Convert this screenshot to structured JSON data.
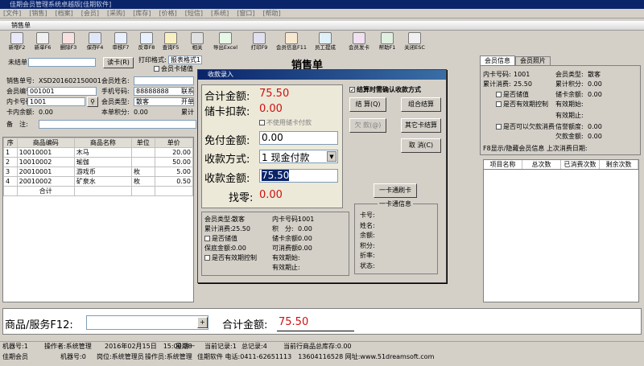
{
  "app": {
    "title": "佳期会员管理系统卓越版[佳期软件]"
  },
  "menu": [
    "[文件]",
    "[销售]",
    "[档案]",
    "[会员]",
    "[采购]",
    "[库存]",
    "[价格]",
    "[短信]",
    "[系统]",
    "[窗口]",
    "[帮助]"
  ],
  "window_title": "销售单",
  "toolbar": [
    {
      "label": "新增F2"
    },
    {
      "label": "新单F6"
    },
    {
      "label": "删除F3"
    },
    {
      "label": "保存F4"
    },
    {
      "label": "审核F7"
    },
    {
      "label": "反审F8"
    },
    {
      "label": "查询F5"
    },
    {
      "label": "相关"
    },
    {
      "label": "导出Excel"
    },
    {
      "label": "打印F9"
    },
    {
      "label": "会员信息F11"
    },
    {
      "label": "员工提成"
    },
    {
      "label": "会员发卡"
    },
    {
      "label": "帮助F1"
    },
    {
      "label": "关闭ESC"
    }
  ],
  "header": {
    "unit_label": "未结单",
    "readcard_btn": "读卡(R)",
    "print_format_label": "打印格式:",
    "print_format_value": "报表格式1",
    "member_check_label": "会员卡储值",
    "doc_title": "销售单",
    "sale_no_label": "销售单号:",
    "sale_no": "XSD201602150001",
    "member_name_label": "会员姓名:",
    "member_no_label": "会员编号:",
    "member_no": "001001",
    "phone_label": "手机号码:",
    "phone": "88888888",
    "contact_label": "联系",
    "card_no_label": "内卡号码:",
    "card_no": "1001",
    "member_type_label": "会员类型:",
    "member_type": "散客",
    "operator_label": "开单",
    "card_balance_label": "卡内余额:",
    "card_balance": "0.00",
    "points_label": "本单积分:",
    "points": "0.00",
    "accum_label": "累计",
    "remark_label": "备　注:"
  },
  "grid": {
    "columns": [
      "序",
      "商品编码",
      "商品名称",
      "单位",
      "单价"
    ],
    "rows": [
      {
        "no": "1",
        "code": "10010001",
        "name": "木马",
        "unit": "",
        "price": "20.00"
      },
      {
        "no": "2",
        "code": "10010002",
        "name": "瑜伽",
        "unit": "",
        "price": "50.00"
      },
      {
        "no": "3",
        "code": "20010001",
        "name": "游戏币",
        "unit": "枚",
        "price": "5.00"
      },
      {
        "no": "4",
        "code": "20010002",
        "name": "矿泉水",
        "unit": "枚",
        "price": "0.50"
      }
    ],
    "total_label": "合计"
  },
  "dialog": {
    "title": "收款录入",
    "total_label": "合计金额:",
    "total": "75.50",
    "card_deduct_label": "储卡扣款:",
    "card_deduct": "0.00",
    "no_card_label": "不使用储卡付款",
    "free_label": "免付金额:",
    "free": "0.00",
    "pay_method_label": "收款方式:",
    "pay_method_no": "1",
    "pay_method": "现金付款",
    "received_label": "收款金额:",
    "received": "75.50",
    "change_label": "找零:",
    "change": "0.00",
    "confirm_label": "结算时需确认收款方式",
    "btn_settle": "结 算(Q)",
    "btn_combo": "组合结算",
    "btn_owe": "欠 款(@)",
    "btn_other": "其它卡结算",
    "btn_cancel": "取 消(C)",
    "card_pay_btn": "一卡通刷卡",
    "member_type_label": "会员类型:",
    "member_type": "散客",
    "card_no_label": "内卡号码:",
    "card_no": "1001",
    "accum_label": "累计消费:",
    "accum": "25.50",
    "points_label": "积　分:",
    "points": "0.00",
    "stored_label": "是否储值",
    "balance_label": "储卡余额:",
    "balance": "0.00",
    "credit_label": "保底金额:",
    "credit": "0.00",
    "owe_limit_label": "可消费额:",
    "owe_limit": "0.00",
    "expire_ctrl_label": "是否有效期控制",
    "valid_from_label": "有效期始:",
    "valid_to_label": "有效期止:",
    "onecard_title": "一卡通信息",
    "onecard_fields": [
      "卡号:",
      "姓名:",
      "余额:",
      "积分:",
      "折率:",
      "状态:"
    ]
  },
  "right_panel": {
    "tabs": [
      "会员信息",
      "会员照片"
    ],
    "card_no_label": "内卡号码:",
    "card_no": "1001",
    "type_label": "会员类型:",
    "type": "散客",
    "accum_label": "累计消费:",
    "accum": "25.50",
    "points_label": "累计积分:",
    "points": "0.00",
    "stored_label": "是否储值",
    "balance_label": "储卡余额:",
    "balance": "0.00",
    "expire_label": "是否有效期控制",
    "valid_from_label": "有效期始:",
    "valid_to_label": "有效期止:",
    "owe_label": "是否可以欠款消费",
    "credit_label": "信誉额度:",
    "credit": "0.00",
    "owed_label": "欠款金额:",
    "owed": "0.00",
    "hint": "F8显示/隐藏会员信息 上次消费日期:",
    "columns": [
      "项目名称",
      "总次数",
      "已消费次数",
      "剩余次数"
    ]
  },
  "bottom": {
    "goods_label": "商品/服务F12:",
    "total_label": "合计金额:",
    "total": "75.50"
  },
  "status1": {
    "machine": "机器号:1",
    "operator": "操作者:系统管理",
    "datetime": "2016年02月15日　15:00:38",
    "weekday": "星期一",
    "record": "当前记录:1",
    "total_records": "总记录:4",
    "stock": "当前行商品总库存:0.00"
  },
  "status2": {
    "company": "佳期会员",
    "machine": "机器号:0",
    "post": "岗位:系统管理员",
    "operator": "操作员:系统管理",
    "contact": "佳期软件 电话:0411-62651113　13604116528 网址:www.51dreamsoft.com"
  }
}
